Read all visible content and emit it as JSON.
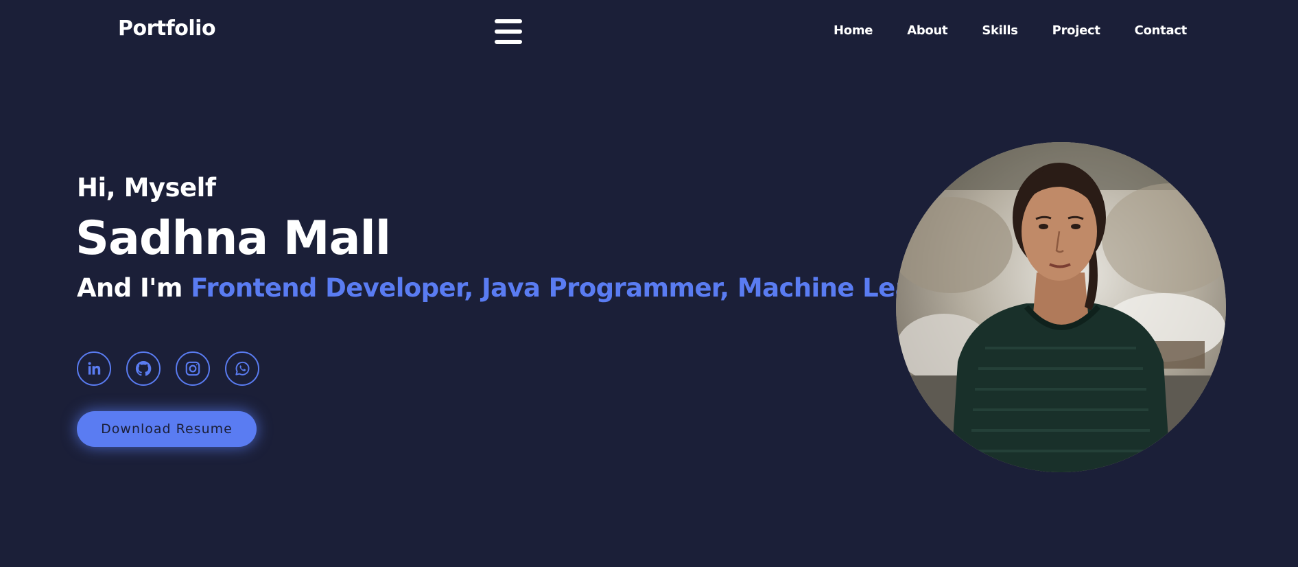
{
  "header": {
    "logo": "Portfolio",
    "menu_icon": "hamburger-menu-icon",
    "nav": [
      {
        "label": "Home"
      },
      {
        "label": "About"
      },
      {
        "label": "Skills"
      },
      {
        "label": "Project"
      },
      {
        "label": "Contact"
      }
    ]
  },
  "hero": {
    "greeting": "Hi, Myself",
    "name": "Sadhna Mall",
    "role_prefix": "And I'm",
    "roles": "Frontend Developer, Java Programmer, Machine Learner",
    "socials": [
      {
        "icon": "linkedin-icon"
      },
      {
        "icon": "github-icon"
      },
      {
        "icon": "instagram-icon"
      },
      {
        "icon": "whatsapp-icon"
      }
    ],
    "download_label": "Download Resume",
    "photo_icon": "profile-photo"
  },
  "colors": {
    "background": "#1b1f38",
    "accent": "#5a7cf2",
    "text": "#ffffff"
  }
}
